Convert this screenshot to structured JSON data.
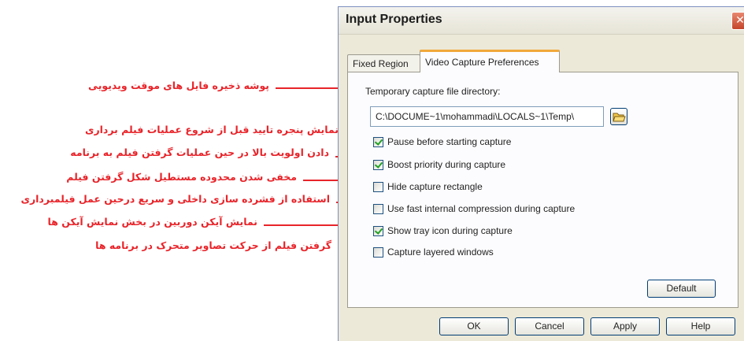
{
  "dialog": {
    "title": "Input Properties",
    "close_glyph": "✕",
    "tabs": [
      {
        "label": "Fixed Region"
      },
      {
        "label": "Video Capture Preferences"
      }
    ],
    "directory_label": "Temporary capture file directory:",
    "directory_value": "C:\\DOCUME~1\\mohammadi\\LOCALS~1\\Temp\\",
    "browse_icon": "folder-open-icon",
    "options": [
      {
        "label": "Pause before starting capture",
        "checked": true
      },
      {
        "label": "Boost priority during capture",
        "checked": true
      },
      {
        "label": "Hide capture rectangle",
        "checked": false
      },
      {
        "label": "Use fast internal compression during capture",
        "checked": false
      },
      {
        "label": "Show tray icon during capture",
        "checked": true
      },
      {
        "label": "Capture layered windows",
        "checked": false
      }
    ],
    "default_label": "Default",
    "buttons": {
      "ok": "OK",
      "cancel": "Cancel",
      "apply": "Apply",
      "help": "Help"
    }
  },
  "annotations": [
    "پوشه ذخیره فایل های موقت ویدیویی",
    "نمایش پنجره تایید قبل از شروع عملیات فیلم برداری",
    "دادن اولویت بالا در حین عملیات گرفتن فیلم به برنامه",
    "مخفی شدن محدوده مستطیل شکل گرفتن فیلم",
    "استفاده از فشرده سازی داخلی و سریع درحین عمل فیلمبرداری",
    "نمایش آیکن دوربین در بخش نمایش آیکن ها",
    "گرفتن فیلم از حرکت تصاویر متحرک در برنامه ها"
  ],
  "colors": {
    "annotation": "#e8242a",
    "tab_highlight": "#f1a83a",
    "check": "#21a121"
  }
}
